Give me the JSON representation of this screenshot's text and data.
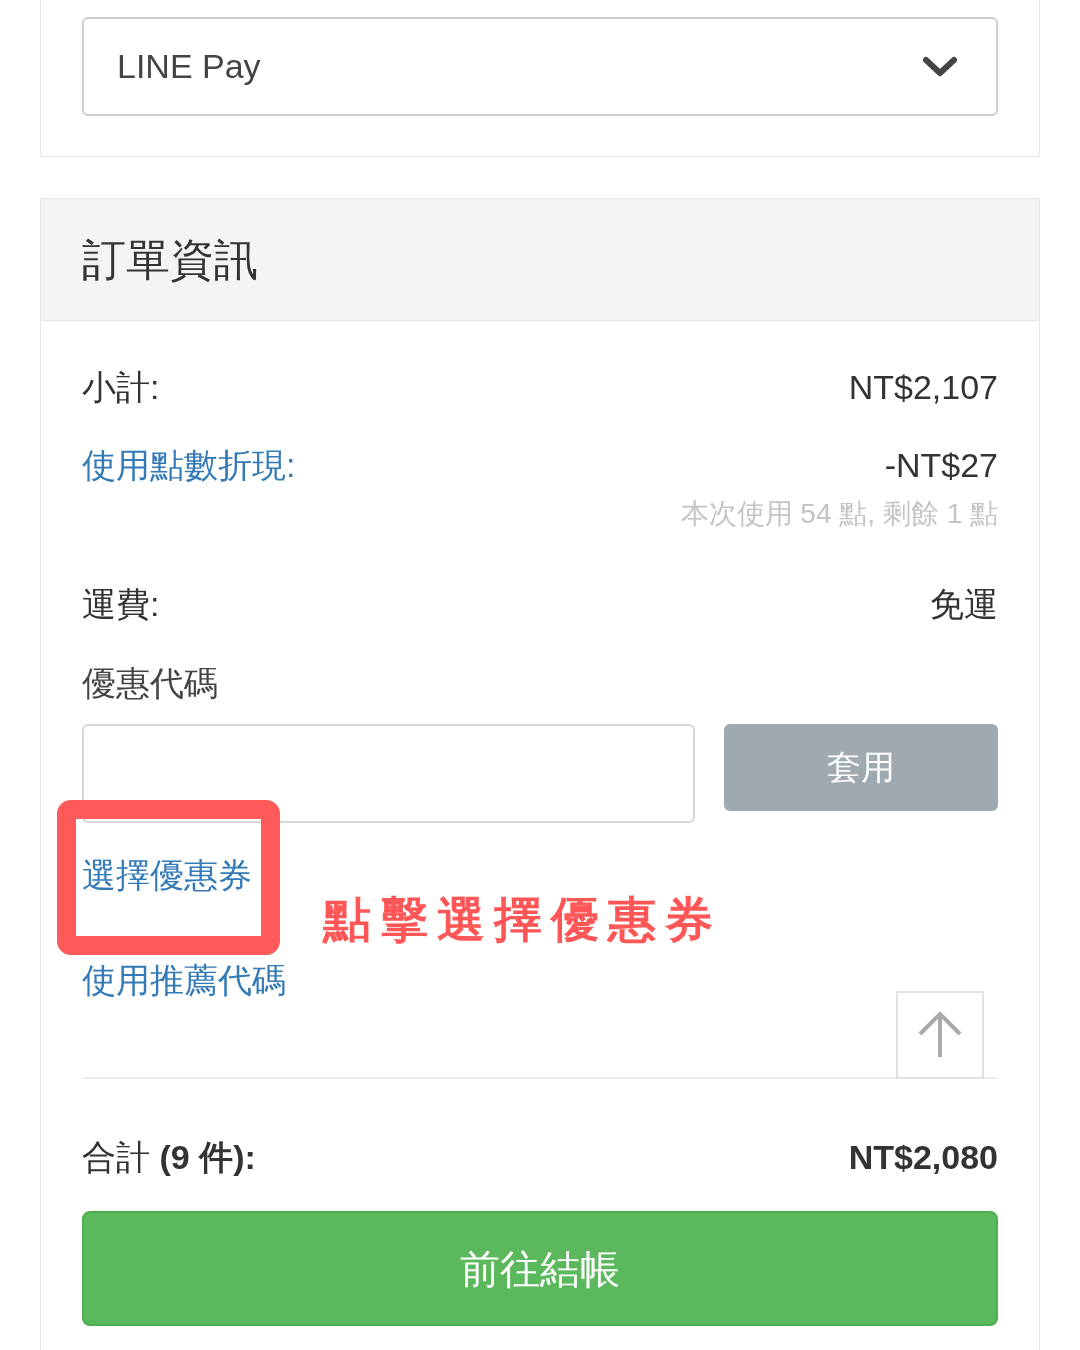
{
  "payment_select": {
    "value": "LINE Pay"
  },
  "order_info": {
    "title": "訂單資訊",
    "rows": [
      {
        "kind": "plain",
        "label": "小計:",
        "value": "NT$2,107"
      },
      {
        "kind": "link",
        "label": "使用點數折現:",
        "value": "-NT$27",
        "note": "本次使用 54 點, 剩餘 1 點"
      },
      {
        "kind": "plain",
        "label": "運費:",
        "value": "免運"
      }
    ],
    "coupon": {
      "label": "優惠代碼",
      "apply_button": "套用"
    },
    "links": [
      {
        "label": "選擇優惠券",
        "highlighted": true
      },
      {
        "label": "使用推薦代碼",
        "highlighted": false
      }
    ],
    "total": {
      "label": "合計 **(9 件):**",
      "value": "NT$2,080"
    },
    "checkout_button": "前往結帳"
  },
  "annotation": {
    "text": "點擊選擇優惠券"
  }
}
